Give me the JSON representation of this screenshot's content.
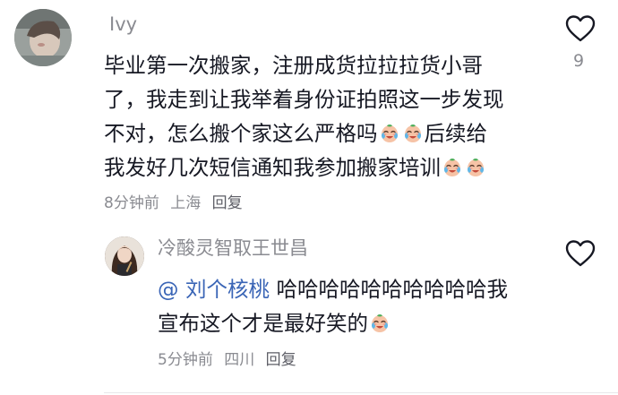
{
  "comment": {
    "username": "Ivy",
    "text_lines": [
      "毕业第一次搬家，注册成货拉拉拉货小哥",
      "了，我走到让我举着身份证拍照这一步发现",
      "不对，怎么搬个家这么严格吗",
      "我发好几次短信通知我参加搬家培训"
    ],
    "line3_suffix": "后续给",
    "time": "8分钟前",
    "location": "上海",
    "reply_label": "回复",
    "like_count": "9",
    "avatar_icon": "profile-avatar-icon",
    "emoji_icon": "crying-laughing-emoji-icon"
  },
  "reply": {
    "username": "冷酸灵智取王世昌",
    "mention": "@ 刘个核桃",
    "text_lines": [
      " 哈哈哈哈哈哈哈哈哈哈我",
      "宣布这个才是最好笑的"
    ],
    "time": "5分钟前",
    "location": "四川",
    "reply_label": "回复",
    "avatar_icon": "profile-avatar-icon",
    "emoji_icon": "crying-laughing-emoji-icon"
  },
  "colors": {
    "text": "#161823",
    "secondary": "#8a8b91",
    "mention": "#3a65b6",
    "heart_stroke": "#161823"
  }
}
